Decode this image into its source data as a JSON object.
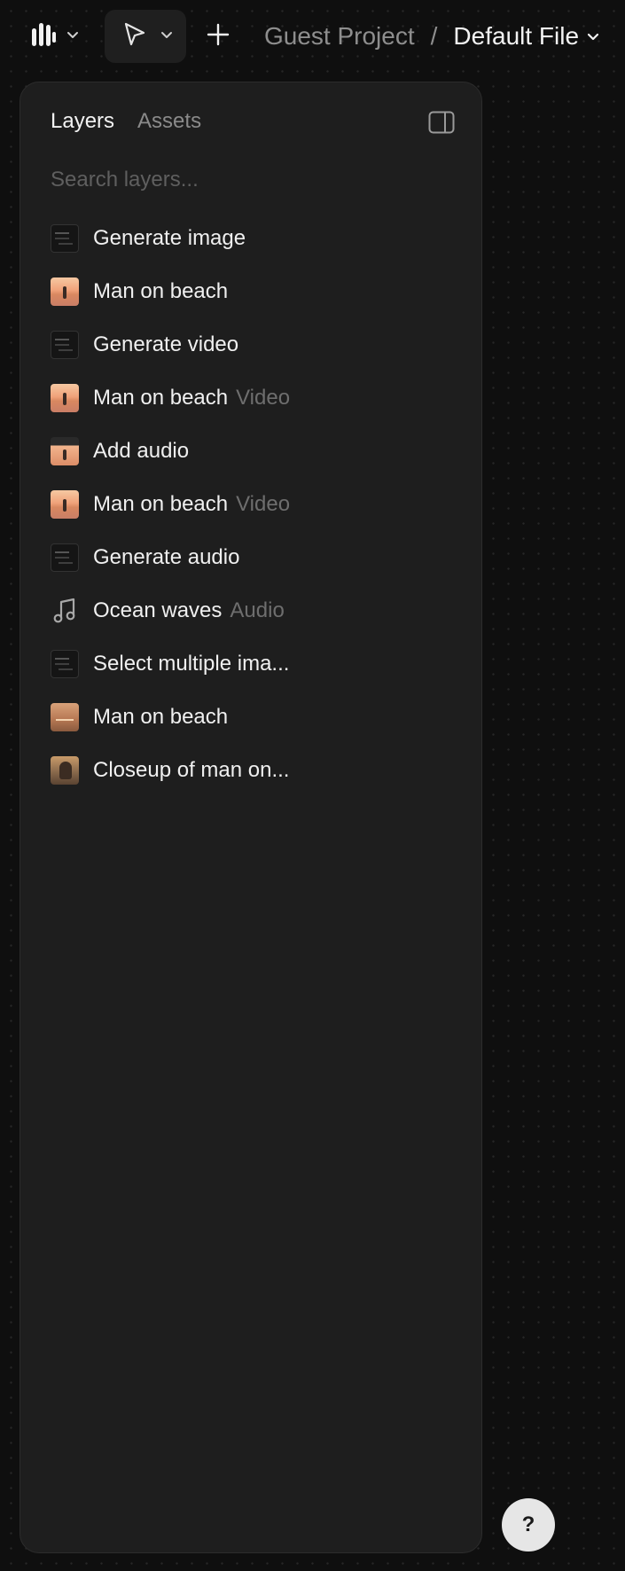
{
  "toolbar": {
    "logo_icon": "brand-logo-icon",
    "logo_chevron_icon": "chevron-down-icon",
    "tool_icon": "cursor-pointer-icon",
    "tool_chevron_icon": "chevron-down-icon",
    "add_icon": "plus-icon"
  },
  "breadcrumb": {
    "project": "Guest Project",
    "separator": "/",
    "file": "Default File",
    "file_chevron_icon": "chevron-down-icon"
  },
  "panel": {
    "tabs": [
      {
        "label": "Layers",
        "active": true
      },
      {
        "label": "Assets",
        "active": false
      }
    ],
    "toggle_icon": "sidebar-toggle-icon",
    "search": {
      "placeholder": "Search layers...",
      "value": ""
    },
    "layers": [
      {
        "name": "Generate image",
        "type": "",
        "thumb": "ui"
      },
      {
        "name": "Man on beach",
        "type": "",
        "thumb": "beach"
      },
      {
        "name": "Generate video",
        "type": "",
        "thumb": "ui"
      },
      {
        "name": "Man on beach",
        "type": "Video",
        "thumb": "beach"
      },
      {
        "name": "Add audio",
        "type": "",
        "thumb": "beach-ui"
      },
      {
        "name": "Man on beach",
        "type": "Video",
        "thumb": "beach"
      },
      {
        "name": "Generate audio",
        "type": "",
        "thumb": "ui"
      },
      {
        "name": "Ocean waves",
        "type": "Audio",
        "thumb": "note"
      },
      {
        "name": "Select multiple ima...",
        "type": "",
        "thumb": "ui"
      },
      {
        "name": "Man on beach",
        "type": "",
        "thumb": "beach-warm"
      },
      {
        "name": "Closeup of man on...",
        "type": "",
        "thumb": "closeup"
      }
    ]
  },
  "help": {
    "label": "?"
  },
  "colors": {
    "canvas_bg": "#0f0f0f",
    "panel_bg": "#1e1e1e",
    "text_primary": "#f0f0f0",
    "text_muted": "#8a8a8a",
    "text_type_tag": "#6e6e6e"
  }
}
